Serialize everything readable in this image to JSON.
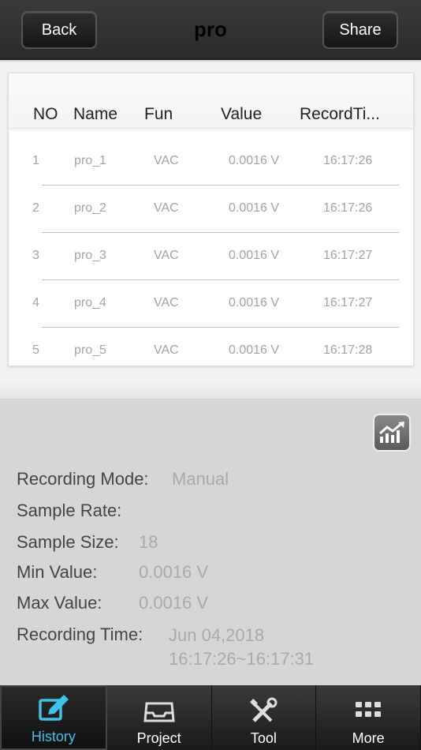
{
  "header": {
    "back_label": "Back",
    "title": "pro",
    "share_label": "Share"
  },
  "table": {
    "columns": [
      "NO",
      "Name",
      "Fun",
      "Value",
      "RecordTi..."
    ],
    "rows": [
      [
        "1",
        "pro_1",
        "VAC",
        "0.0016 V",
        "16:17:26"
      ],
      [
        "2",
        "pro_2",
        "VAC",
        "0.0016 V",
        "16:17:26"
      ],
      [
        "3",
        "pro_3",
        "VAC",
        "0.0016 V",
        "16:17:27"
      ],
      [
        "4",
        "pro_4",
        "VAC",
        "0.0016 V",
        "16:17:27"
      ],
      [
        "5",
        "pro_5",
        "VAC",
        "0.0016 V",
        "16:17:28"
      ]
    ]
  },
  "info": {
    "chart_icon": "line-chart-icon",
    "recording_mode_label": "Recording Mode:",
    "recording_mode_value": "Manual",
    "sample_rate_label": "Sample Rate:",
    "sample_rate_value": "",
    "sample_size_label": "Sample Size:",
    "sample_size_value": "18",
    "min_label": "Min Value:",
    "min_value": "0.0016 V",
    "max_label": "Max Value:",
    "max_value": "0.0016 V",
    "recording_time_label": "Recording Time:",
    "recording_time_date": "Jun 04,2018",
    "recording_time_range": "16:17:26~16:17:31"
  },
  "tabs": [
    {
      "label": "History",
      "icon": "edit-icon",
      "active": true
    },
    {
      "label": "Project",
      "icon": "inbox-icon",
      "active": false
    },
    {
      "label": "Tool",
      "icon": "tools-icon",
      "active": false
    },
    {
      "label": "More",
      "icon": "grid-icon",
      "active": false
    }
  ],
  "colors": {
    "active_tab": "#3ec3e6",
    "header_bg": "#2b2b2b"
  }
}
